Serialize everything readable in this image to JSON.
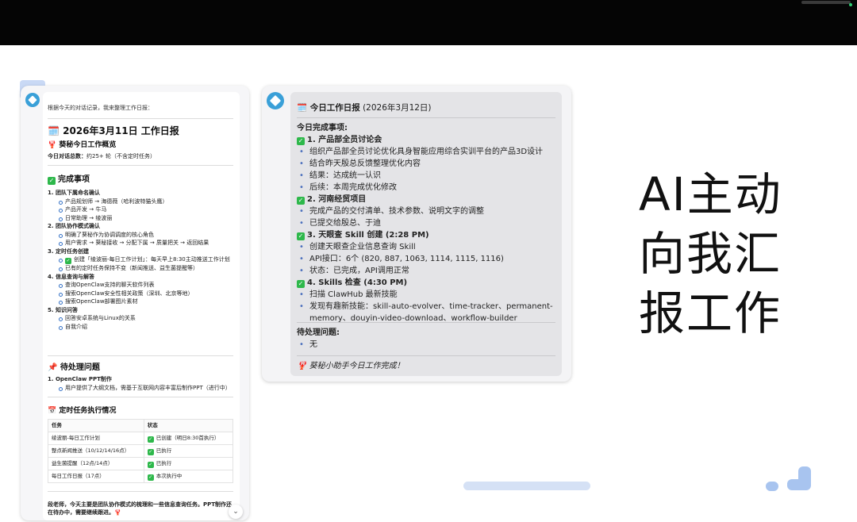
{
  "left": {
    "intro": "根据今天的对话记录，我来整理工作日报：",
    "title": "🗓️ 2026年3月11日 工作日报",
    "overview": "🦞 葵秘今日工作概览",
    "duration_label": "今日对话总数：",
    "duration_value": "约25+ 轮（不含定时任务）",
    "done_heading": "完成事项",
    "done": [
      {
        "num": "1. 团队下属命名确认",
        "subs": [
          "产品规划师 → 海德薇（哈利波特猫头鹰）",
          "产品开发 → 牛马",
          "日常助理 → 绫波丽"
        ]
      },
      {
        "num": "2. 团队协作模式确认",
        "subs": [
          "明确了葵秘作为协调调度的核心角色",
          "用户需求 → 葵秘接收 → 分配下属 → 质量把关 → 返回结果"
        ]
      },
      {
        "num": "3. 定时任务创建",
        "subs": [
          "创建「绫波丽-每日工作计划」：每天早上8:30主动推送工作计划",
          "已有的定时任务保持不变（新闻推送、益生菌提醒等）"
        ]
      },
      {
        "num": "4. 信息查询与解答",
        "subs": [
          "查询OpenClaw支持的聊天软件列表",
          "搜索OpenClaw安全性相关政策（深圳、北京等地）",
          "搜索OpenClaw部署图片素材"
        ]
      },
      {
        "num": "5. 知识问答",
        "subs": [
          "回答安卓系统与Linux的关系",
          "自我介绍"
        ]
      }
    ],
    "pending_heading": "📌 待处理问题",
    "pending": [
      {
        "num": "1. OpenClaw PPT制作",
        "subs": [
          "用户提供了大纲文档，需基于互联网内容丰富后制作PPT（进行中）"
        ]
      }
    ],
    "table_heading": "📅 定时任务执行情况",
    "table_headers": [
      "任务",
      "状态"
    ],
    "table_rows": [
      [
        "绫波丽-每日工作计划",
        "已创建（明日8:30首执行）"
      ],
      [
        "整点新闻推送（10/12/14/16点）",
        "已执行"
      ],
      [
        "益生菌提醒（12点/14点）",
        "已执行"
      ],
      [
        "每日工作日报（17点）",
        "本次执行中"
      ]
    ],
    "footer": "段老师，今天主要是团队协作模式的梳理和一些信息查询任务。PPT制作还在待办中，需要继续跟进。🦞"
  },
  "right": {
    "title": "🗓️ 今日工作日报",
    "date": "(2026年3月12日)",
    "done_label": "今日完成事项:",
    "sections": [
      {
        "head": "1. 产品部全员讨论会",
        "items": [
          "组织产品部全员讨论优化具身智能应用综合实训平台的产品3D设计",
          "结合昨天殷总反馈整理优化内容",
          "结果：达成统一认识",
          "后续：本周完成优化修改"
        ]
      },
      {
        "head": "2. 河南经贸项目",
        "items": [
          "完成产品的交付清单、技术参数、说明文字的调整",
          "已提交给殷总、于迪"
        ]
      },
      {
        "head": "3. 天眼查 Skill 创建 (2:28 PM)",
        "items": [
          "创建天眼查企业信息查询 Skill",
          "API接口：6个 (820, 887, 1063, 1114, 1115, 1116)",
          "状态：已完成，API调用正常"
        ]
      },
      {
        "head": "4. Skills 检查 (4:30 PM)",
        "items": [
          "扫描 ClawHub 最新技能",
          "发现有趣新技能：skill-auto-evolver、time-tracker、permanent-memory、douyin-video-download、workflow-builder"
        ]
      }
    ],
    "pending_label": "待处理问题:",
    "pending_items": [
      "无"
    ],
    "footer": "🦞 葵秘小助手今日工作完成！"
  },
  "headline": [
    "AI主动",
    "向我汇",
    "报工作"
  ],
  "colors": {
    "check": "#2eb84b",
    "avatar": "#3aa0d8",
    "accent": "#a8c4ef"
  }
}
